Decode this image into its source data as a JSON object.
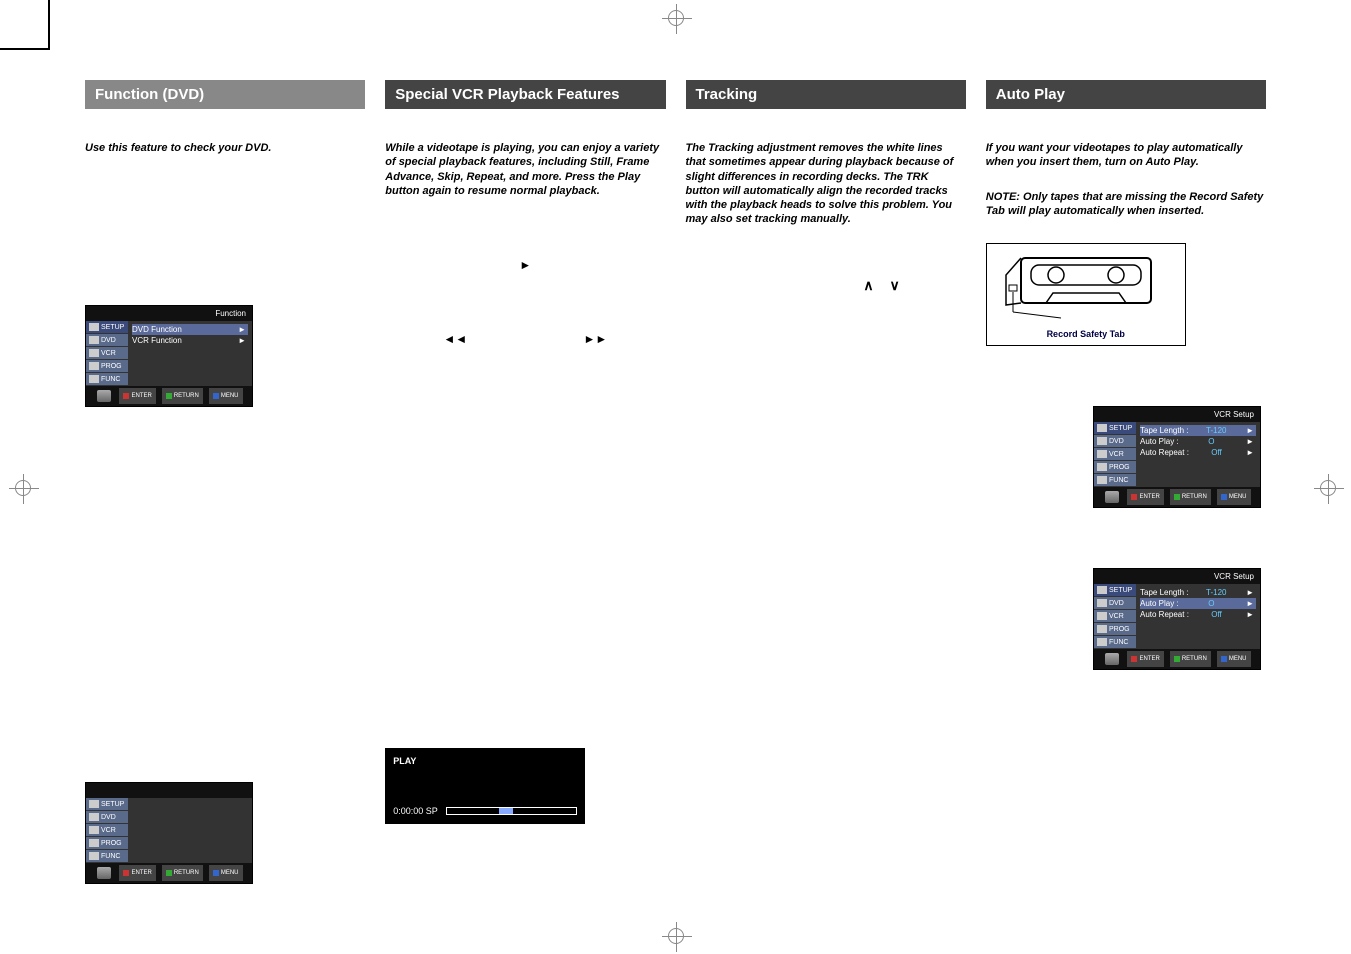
{
  "col1": {
    "header": "Function (DVD)",
    "intro": "Use this feature to check your DVD.",
    "osd1": {
      "title": "Function",
      "tabs": [
        "SETUP",
        "DVD",
        "VCR",
        "PROG",
        "FUNC"
      ],
      "rows": [
        {
          "label": "DVD Function",
          "sel": true
        },
        {
          "label": "VCR Function",
          "sel": false
        }
      ]
    },
    "osd2": {
      "title": "",
      "tabs": [
        "SETUP",
        "DVD",
        "VCR",
        "PROG",
        "FUNC"
      ]
    }
  },
  "col2": {
    "header": "Special VCR Playback Features",
    "intro": "While a videotape is playing, you can enjoy a variety of special playback features, including Still, Frame Advance, Skip, Repeat, and more. Press the Play button again to resume normal playback.",
    "play_osd": {
      "label": "PLAY",
      "time": "0:00:00 SP"
    }
  },
  "col3": {
    "header": "Tracking",
    "intro": "The Tracking adjustment removes the white lines that sometimes appear during playback because of slight differences in recording decks. The TRK button will automatically align the recorded tracks with the playback heads to solve this problem. You may also set tracking manually."
  },
  "col4": {
    "header": "Auto Play",
    "intro": "If you want your videotapes to play automatically when you insert them, turn on Auto Play.",
    "note": "NOTE: Only tapes that are missing the Record Safety Tab will play automatically when inserted.",
    "cassette_caption": "Record Safety Tab",
    "vcr_setup": {
      "title": "VCR Setup",
      "tabs": [
        "SETUP",
        "DVD",
        "VCR",
        "PROG",
        "FUNC"
      ],
      "rows": [
        {
          "label": "Tape Length :",
          "val": "T-120"
        },
        {
          "label": "Auto Play :",
          "val": "O"
        },
        {
          "label": "Auto Repeat :",
          "val": "Off"
        }
      ]
    },
    "vcr_setup2": {
      "title": "VCR Setup",
      "rows_sel_index": 1,
      "rows": [
        {
          "label": "Tape Length :",
          "val": "T-120"
        },
        {
          "label": "Auto Play :",
          "val": "O"
        },
        {
          "label": "Auto Repeat :",
          "val": "Off"
        }
      ]
    }
  },
  "osd_footer": {
    "enter": "ENTER",
    "return": "RETURN",
    "menu": "MENU"
  }
}
